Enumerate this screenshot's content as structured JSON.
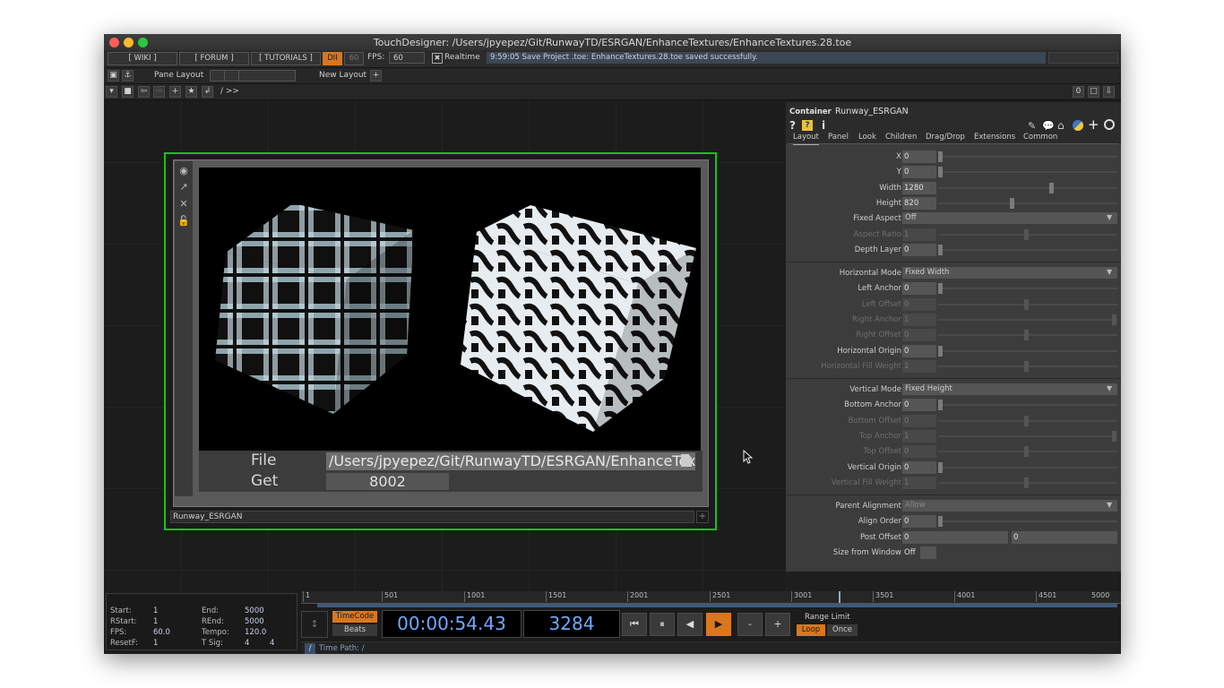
{
  "window": {
    "title": "TouchDesigner: /Users/jpyepez/Git/RunwayTD/ESRGAN/EnhanceTextures/EnhanceTextures.28.toe"
  },
  "menubar": {
    "wiki": "[ WIKI ]",
    "forum": "[ FORUM ]",
    "tutorials": "[ TUTORIALS ]",
    "dii": "DII",
    "fps_badge": "60",
    "fps_label": "FPS:",
    "fps_value": "60",
    "realtime_check": "✖",
    "realtime": "Realtime",
    "status": "9:59:05 Save Project .toe: EnhanceTextures.28.toe saved successfully."
  },
  "panebar": {
    "pane_layout": "Pane Layout",
    "new_layout": "New Layout",
    "plus": "+"
  },
  "pathbar": {
    "path": "/ >>",
    "counter": "0"
  },
  "container_node": {
    "file_label": "File",
    "file_value": "/Users/jpyepez/Git/RunwayTD/ESRGAN/EnhanceTextures",
    "get_label": "Get",
    "get_value": "8002",
    "name": "Runway_ESRGAN",
    "plus": "+"
  },
  "params": {
    "op_type": "Container",
    "op_name": "Runway_ESRGAN",
    "tabs": [
      "Layout",
      "Panel",
      "Look",
      "Children",
      "Drag/Drop",
      "Extensions",
      "Common"
    ],
    "rows": [
      {
        "label": "X",
        "value": "0"
      },
      {
        "label": "Y",
        "value": "0"
      },
      {
        "label": "Width",
        "value": "1280"
      },
      {
        "label": "Height",
        "value": "820"
      },
      {
        "label": "Fixed Aspect",
        "value": "Off"
      },
      {
        "label": "Aspect Ratio",
        "value": "1"
      },
      {
        "label": "Depth Layer",
        "value": "0"
      },
      {
        "label": "Horizontal Mode",
        "value": "Fixed Width"
      },
      {
        "label": "Left Anchor",
        "value": "0"
      },
      {
        "label": "Left Offset",
        "value": "0"
      },
      {
        "label": "Right Anchor",
        "value": "1"
      },
      {
        "label": "Right Offset",
        "value": "0"
      },
      {
        "label": "Horizontal Origin",
        "value": "0"
      },
      {
        "label": "Horizontal Fill Weight",
        "value": "1"
      },
      {
        "label": "Vertical Mode",
        "value": "Fixed Height"
      },
      {
        "label": "Bottom Anchor",
        "value": "0"
      },
      {
        "label": "Bottom Offset",
        "value": "0"
      },
      {
        "label": "Top Anchor",
        "value": "1"
      },
      {
        "label": "Top Offset",
        "value": "0"
      },
      {
        "label": "Vertical Origin",
        "value": "0"
      },
      {
        "label": "Vertical Fill Weight",
        "value": "1"
      },
      {
        "label": "Parent Alignment",
        "value": "Allow"
      },
      {
        "label": "Align Order",
        "value": "0"
      },
      {
        "label": "Post Offset",
        "value": "0",
        "value2": "0"
      },
      {
        "label": "Size from Window",
        "value": "Off"
      }
    ]
  },
  "timeline": {
    "start_k": "Start:",
    "start_v": "1",
    "end_k": "End:",
    "end_v": "5000",
    "rstart_k": "RStart:",
    "rstart_v": "1",
    "rend_k": "REnd:",
    "rend_v": "5000",
    "fps_k": "FPS:",
    "fps_v": "60.0",
    "tempo_k": "Tempo:",
    "tempo_v": "120.0",
    "resetf_k": "ResetF:",
    "resetf_v": "1",
    "tsig_k": "T Sig:",
    "tsig_v1": "4",
    "tsig_v2": "4",
    "ruler": [
      "1",
      "501",
      "1001",
      "1501",
      "2001",
      "2501",
      "3001",
      "3501",
      "4001",
      "4501",
      "5000"
    ],
    "timecode_btn": "TimeCode",
    "beats_btn": "Beats",
    "timecode": "00:00:54.43",
    "frame": "3284",
    "range_limit": "Range Limit",
    "loop": "Loop",
    "once": "Once",
    "time_path_root": "/",
    "time_path": "Time Path: /",
    "minus": "-",
    "plus": "+"
  }
}
